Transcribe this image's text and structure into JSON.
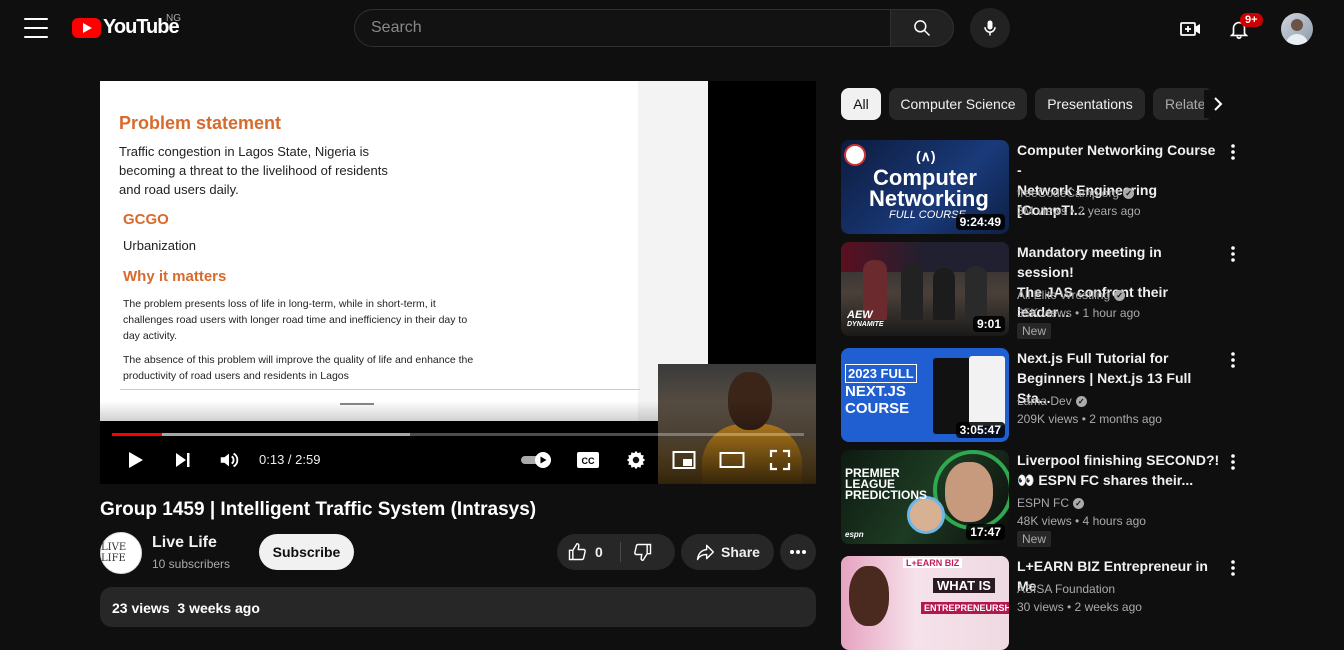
{
  "header": {
    "logo_text": "YouTube",
    "country_code": "NG",
    "search_placeholder": "Search",
    "notification_count": "9+"
  },
  "player": {
    "slide": {
      "heading1": "Problem statement",
      "para1_line1": "Traffic congestion in Lagos State, Nigeria is",
      "para1_line2": "becoming a threat to the livelihood of residents",
      "para1_line3": "and road users daily.",
      "heading2": "GCGO",
      "para2": "Urbanization",
      "heading3": "Why it matters",
      "para3_line1": "The problem presents loss of life in long-term, while in short-term, it",
      "para3_line2": "challenges road users with longer road time and inefficiency in their day to",
      "para3_line3": "day activity.",
      "para4_line1": "The absence of this problem will improve the quality of life and enhance the",
      "para4_line2": "productivity of road users and residents in Lagos"
    },
    "time_display": "0:13 / 2:59",
    "progress_played_fraction": 0.072,
    "progress_buffered_fraction": 0.43
  },
  "video": {
    "title": "Group 1459 | Intelligent Traffic System (Intrasys)",
    "channel_avatar_text": "LIVE LIFE",
    "channel_name": "Live Life",
    "subscribers": "10 subscribers",
    "subscribe_label": "Subscribe",
    "likes": "0",
    "share_label": "Share",
    "views": "23 views",
    "uploaded": "3 weeks ago"
  },
  "chips": [
    "All",
    "Computer Science",
    "Presentations",
    "Related"
  ],
  "recommendations": [
    {
      "title_line1": "Computer Networking Course -",
      "title_line2": "Network Engineering [CompTI...",
      "channel": "freeCodeCamp.org",
      "verified": true,
      "meta": "3M views  • 2 years ago",
      "duration": "9:24:49",
      "new": "",
      "thumb_text1": "Computer",
      "thumb_text2": "Networking",
      "thumb_text3": "FULL COURSE"
    },
    {
      "title_line1": "Mandatory meeting in session!",
      "title_line2": "The JAS confront their leader...",
      "channel": "All Elite Wrestling",
      "verified": true,
      "meta": "35K views  • 1 hour ago",
      "duration": "9:01",
      "new": "New",
      "thumb_text1": "AEW",
      "thumb_text2": "DYNAMITE"
    },
    {
      "title_line1": "Next.js Full Tutorial for",
      "title_line2": "Beginners | Next.js 13 Full Sta...",
      "channel": "Lama Dev",
      "verified": true,
      "meta": "209K views  • 2 months ago",
      "duration": "3:05:47",
      "new": "",
      "thumb_text1": "2023 FULL",
      "thumb_text2": "NEXT.JS",
      "thumb_text3": "COURSE"
    },
    {
      "title_line1": "Liverpool finishing SECOND?!",
      "title_line2": "👀 ESPN FC shares their...",
      "channel": "ESPN FC",
      "verified": true,
      "meta": "48K views  • 4 hours ago",
      "duration": "17:47",
      "new": "New",
      "thumb_text1": "PREMIER",
      "thumb_text2": "LEAGUE",
      "thumb_text3": "PREDICTIONS",
      "thumb_text4": "espn"
    },
    {
      "title_line1": "L+EARN BIZ Entrepreneur in Me",
      "title_line2": "",
      "channel": "ASISA Foundation",
      "verified": false,
      "meta": "30 views  • 2 weeks ago",
      "duration": "",
      "new": "",
      "thumb_text1": "L+EARN BIZ",
      "thumb_text2": "WHAT IS",
      "thumb_text3": "ENTREPRENEURSHIP?"
    }
  ],
  "colors": {
    "background": "#0f0f0f",
    "brand_red": "#ff0000",
    "slide_heading": "#d86a2c",
    "pill": "#272727"
  }
}
